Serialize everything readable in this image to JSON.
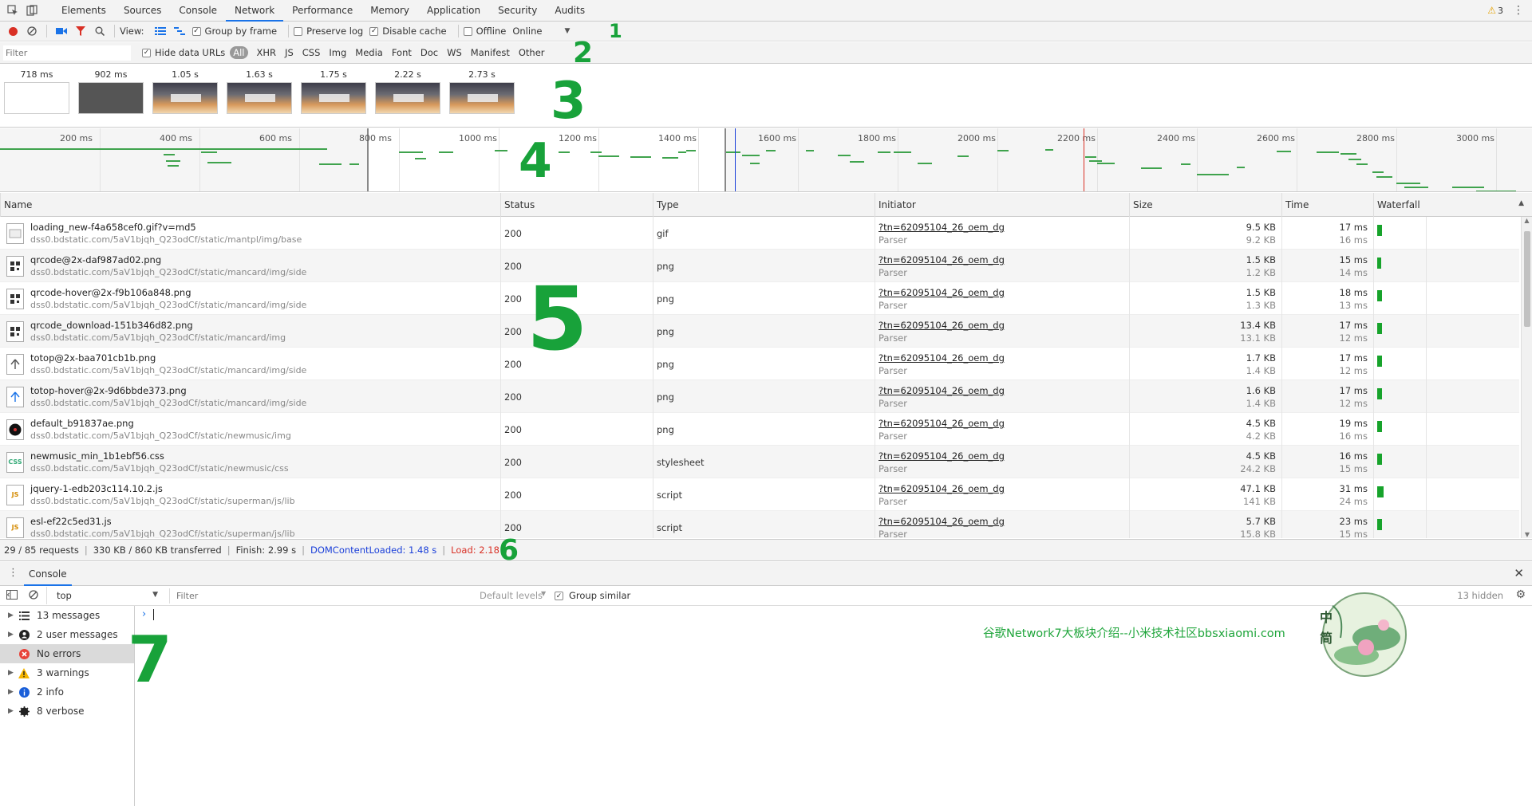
{
  "tabs": [
    "Elements",
    "Sources",
    "Console",
    "Network",
    "Performance",
    "Memory",
    "Application",
    "Security",
    "Audits"
  ],
  "warning_count": "3",
  "toolbar": {
    "view_label": "View:",
    "group_by_frame": "Group by frame",
    "preserve_log": "Preserve log",
    "disable_cache": "Disable cache",
    "offline": "Offline",
    "throttle": "Online"
  },
  "filter": {
    "placeholder": "Filter",
    "hide_data_urls": "Hide data URLs",
    "types": [
      "All",
      "XHR",
      "JS",
      "CSS",
      "Img",
      "Media",
      "Font",
      "Doc",
      "WS",
      "Manifest",
      "Other"
    ]
  },
  "filmstrip": {
    "times": [
      "718 ms",
      "902 ms",
      "1.05 s",
      "1.63 s",
      "1.75 s",
      "2.22 s",
      "2.73 s"
    ]
  },
  "overview": {
    "ticks": [
      "200 ms",
      "400 ms",
      "600 ms",
      "800 ms",
      "1000 ms",
      "1200 ms",
      "1400 ms",
      "1600 ms",
      "1800 ms",
      "2000 ms",
      "2200 ms",
      "2400 ms",
      "2600 ms",
      "2800 ms",
      "3000 ms"
    ]
  },
  "columns": [
    "Name",
    "Status",
    "Type",
    "Initiator",
    "Size",
    "Time",
    "Waterfall"
  ],
  "rows": [
    {
      "name": "loading_new-f4a658cef0.gif?v=md5",
      "path": "dss0.bdstatic.com/5aV1bjqh_Q23odCf/static/mantpl/img/base",
      "status": "200",
      "type": "gif",
      "initiator": "?tn=62095104_26_oem_dg",
      "initiator_type": "Parser",
      "size": "9.5 KB",
      "size2": "9.2 KB",
      "time": "17 ms",
      "time2": "16 ms",
      "icon": "img"
    },
    {
      "name": "qrcode@2x-daf987ad02.png",
      "path": "dss0.bdstatic.com/5aV1bjqh_Q23odCf/static/mancard/img/side",
      "status": "200",
      "type": "png",
      "initiator": "?tn=62095104_26_oem_dg",
      "initiator_type": "Parser",
      "size": "1.5 KB",
      "size2": "1.2 KB",
      "time": "15 ms",
      "time2": "14 ms",
      "icon": "qr"
    },
    {
      "name": "qrcode-hover@2x-f9b106a848.png",
      "path": "dss0.bdstatic.com/5aV1bjqh_Q23odCf/static/mancard/img/side",
      "status": "200",
      "type": "png",
      "initiator": "?tn=62095104_26_oem_dg",
      "initiator_type": "Parser",
      "size": "1.5 KB",
      "size2": "1.3 KB",
      "time": "18 ms",
      "time2": "13 ms",
      "icon": "qr"
    },
    {
      "name": "qrcode_download-151b346d82.png",
      "path": "dss0.bdstatic.com/5aV1bjqh_Q23odCf/static/mancard/img",
      "status": "200",
      "type": "png",
      "initiator": "?tn=62095104_26_oem_dg",
      "initiator_type": "Parser",
      "size": "13.4 KB",
      "size2": "13.1 KB",
      "time": "17 ms",
      "time2": "12 ms",
      "icon": "qr"
    },
    {
      "name": "totop@2x-baa701cb1b.png",
      "path": "dss0.bdstatic.com/5aV1bjqh_Q23odCf/static/mancard/img/side",
      "status": "200",
      "type": "png",
      "initiator": "?tn=62095104_26_oem_dg",
      "initiator_type": "Parser",
      "size": "1.7 KB",
      "size2": "1.4 KB",
      "time": "17 ms",
      "time2": "12 ms",
      "icon": "up"
    },
    {
      "name": "totop-hover@2x-9d6bbde373.png",
      "path": "dss0.bdstatic.com/5aV1bjqh_Q23odCf/static/mancard/img/side",
      "status": "200",
      "type": "png",
      "initiator": "?tn=62095104_26_oem_dg",
      "initiator_type": "Parser",
      "size": "1.6 KB",
      "size2": "1.4 KB",
      "time": "17 ms",
      "time2": "12 ms",
      "icon": "up"
    },
    {
      "name": "default_b91837ae.png",
      "path": "dss0.bdstatic.com/5aV1bjqh_Q23odCf/static/newmusic/img",
      "status": "200",
      "type": "png",
      "initiator": "?tn=62095104_26_oem_dg",
      "initiator_type": "Parser",
      "size": "4.5 KB",
      "size2": "4.2 KB",
      "time": "19 ms",
      "time2": "16 ms",
      "icon": "disc"
    },
    {
      "name": "newmusic_min_1b1ebf56.css",
      "path": "dss0.bdstatic.com/5aV1bjqh_Q23odCf/static/newmusic/css",
      "status": "200",
      "type": "stylesheet",
      "initiator": "?tn=62095104_26_oem_dg",
      "initiator_type": "Parser",
      "size": "4.5 KB",
      "size2": "24.2 KB",
      "time": "16 ms",
      "time2": "15 ms",
      "icon": "CSS"
    },
    {
      "name": "jquery-1-edb203c114.10.2.js",
      "path": "dss0.bdstatic.com/5aV1bjqh_Q23odCf/static/superman/js/lib",
      "status": "200",
      "type": "script",
      "initiator": "?tn=62095104_26_oem_dg",
      "initiator_type": "Parser",
      "size": "47.1 KB",
      "size2": "141 KB",
      "time": "31 ms",
      "time2": "24 ms",
      "icon": "JS"
    },
    {
      "name": "esl-ef22c5ed31.js",
      "path": "dss0.bdstatic.com/5aV1bjqh_Q23odCf/static/superman/js/lib",
      "status": "200",
      "type": "script",
      "initiator": "?tn=62095104_26_oem_dg",
      "initiator_type": "Parser",
      "size": "5.7 KB",
      "size2": "15.8 KB",
      "time": "23 ms",
      "time2": "15 ms",
      "icon": "JS"
    }
  ],
  "waterfall_width_fraction": [
    0.2,
    0.12,
    0.15,
    0.22,
    0.18,
    0.18,
    0.2,
    0.18,
    0.35,
    0.22
  ],
  "status": {
    "requests": "29 / 85 requests",
    "transferred": "330 KB / 860 KB transferred",
    "finish": "Finish: 2.99 s",
    "dcl": "DOMContentLoaded: 1.48 s",
    "load": "Load: 2.18 s"
  },
  "drawer": {
    "tab": "Console",
    "context": "top",
    "filter_placeholder": "Filter",
    "levels": "Default levels",
    "group_similar": "Group similar",
    "hidden": "13 hidden",
    "prompt": "›"
  },
  "sidebar": [
    {
      "label": "13 messages",
      "icon": "list"
    },
    {
      "label": "2 user messages",
      "icon": "user"
    },
    {
      "label": "No errors",
      "icon": "error"
    },
    {
      "label": "3 warnings",
      "icon": "warning"
    },
    {
      "label": "2 info",
      "icon": "info"
    },
    {
      "label": "8 verbose",
      "icon": "verbose"
    }
  ],
  "annotations": [
    "1",
    "2",
    "3",
    "4",
    "5",
    "6",
    "7"
  ],
  "watermark": "谷歌Network7大板块介绍--小米技术社区bbsxiaomi.com",
  "logo_text": "中简"
}
